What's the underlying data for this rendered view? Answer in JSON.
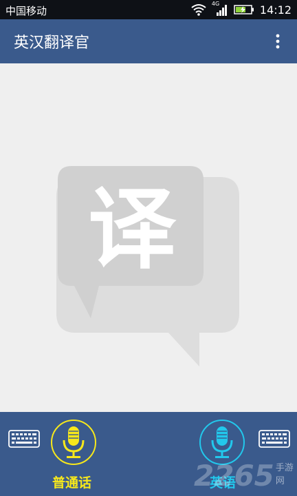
{
  "status_bar": {
    "carrier": "中国移动",
    "network": "4G",
    "time": "14:12",
    "icons": [
      "wifi-icon",
      "cellular-signal-icon",
      "battery-charging-icon"
    ]
  },
  "app_bar": {
    "title": "英汉翻译官",
    "menu_icon": "overflow-menu-icon",
    "color": "#3a5a8c"
  },
  "content": {
    "placeholder_logo_text": "译"
  },
  "bottom_bar": {
    "left_keyboard_icon": "keyboard-icon",
    "right_keyboard_icon": "keyboard-icon",
    "chinese_mic": {
      "label": "普通话",
      "icon": "microphone-icon",
      "color": "#f7e81b"
    },
    "english_mic": {
      "label": "英语",
      "icon": "microphone-icon",
      "color": "#22c8ec"
    }
  },
  "watermark": {
    "number": "2265",
    "text": "手游网"
  }
}
